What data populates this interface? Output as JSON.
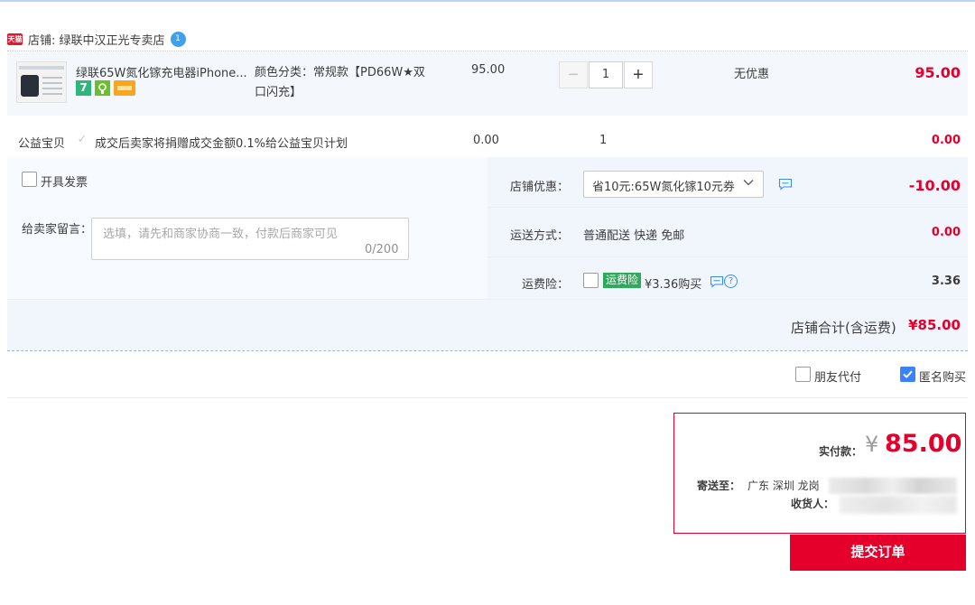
{
  "shop": {
    "badge": "天猫",
    "name": "店铺: 绿联中汉正光专卖店",
    "ww_badge": "1"
  },
  "product": {
    "title": "绿联65W氮化镓充电器iPhone...",
    "sku": "颜色分类：常规款【PD66W★双口闪充】",
    "price": "95.00",
    "quantity": "1",
    "minus": "−",
    "plus": "+",
    "discount": "无优惠",
    "subtotal": "95.00",
    "service_badge_1": "7",
    "service_icons": [
      "seven-day-return-icon",
      "guarantee-icon",
      "card-payment-icon"
    ]
  },
  "charity": {
    "label": "公益宝贝",
    "check": "✓",
    "text": "成交后卖家将捐赠成交金额0.1%给公益宝贝计划",
    "price": "0.00",
    "quantity": "1",
    "subtotal": "0.00"
  },
  "options": {
    "invoice_label": "开具发票",
    "message_label": "给卖家留言：",
    "message_placeholder": "选填，请先和商家协商一致，付款后商家可见",
    "message_count": "0/200",
    "coupon_label": "店铺优惠：",
    "coupon_value": "省10元:65W氮化镓10元券",
    "coupon_amount": "-10.00",
    "shipping_label": "运送方式：",
    "shipping_value": "普通配送 快递 免邮",
    "shipping_amount": "0.00",
    "insurance_label": "运费险：",
    "insurance_tag": "运费险",
    "insurance_text": "¥3.36购买",
    "insurance_help": "?",
    "insurance_amount": "3.36",
    "total_label": "店铺合计(含运费)",
    "total_amount": "¥85.00"
  },
  "extras": {
    "friend_pay_label": "朋友代付",
    "anonymous_label": "匿名购买",
    "anonymous_checked": true
  },
  "checkout": {
    "pay_label": "实付款：",
    "currency": "¥",
    "amount": "85.00",
    "ship_to_label": "寄送至：",
    "ship_to_value": "广东 深圳 龙岗",
    "receiver_label": "收货人：",
    "submit_label": "提交订单"
  },
  "colors": {
    "accent_red": "#e4002b",
    "option_bg": "#f1f6fd",
    "checkbox_blue": "#3b82f6",
    "insurance_green": "#2fa95b"
  }
}
